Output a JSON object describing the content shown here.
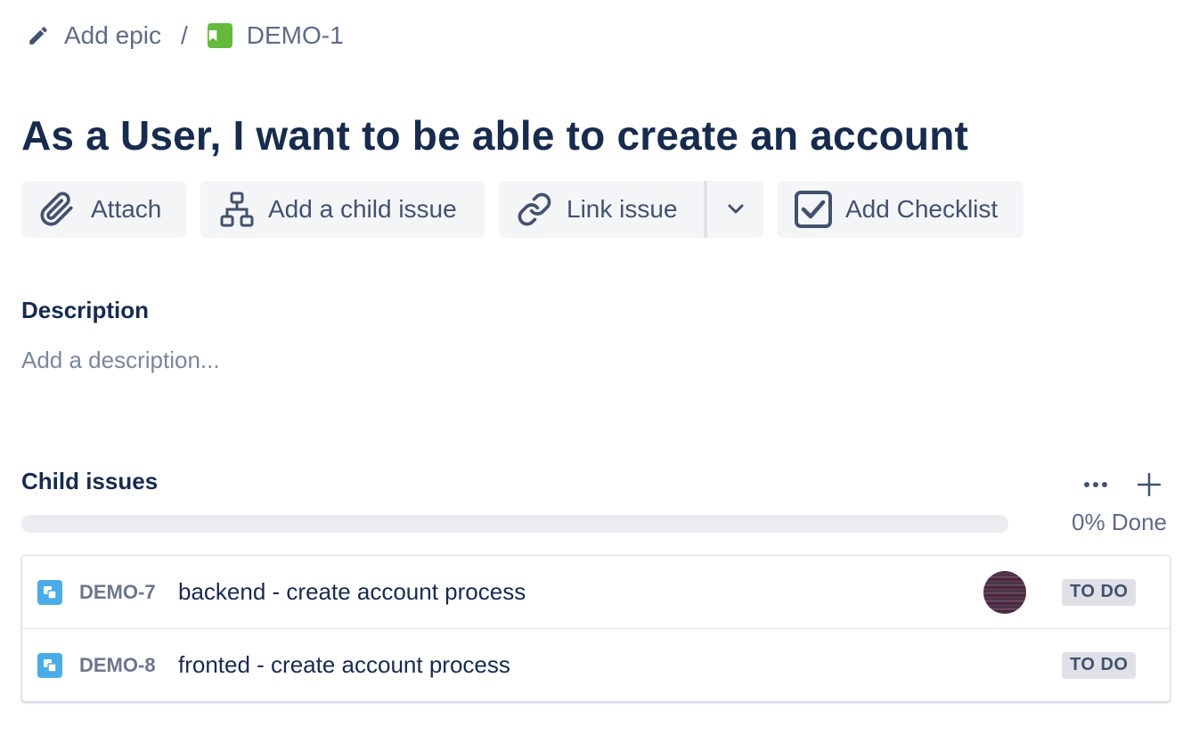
{
  "breadcrumb": {
    "epic_label": "Add epic",
    "separator": "/",
    "issue_key": "DEMO-1",
    "issue_type_icon": "story-bookmark-icon"
  },
  "title": "As a User, I want to be able to create an account",
  "toolbar": {
    "attach": "Attach",
    "add_child": "Add a child issue",
    "link_issue": "Link issue",
    "add_checklist": "Add Checklist"
  },
  "description": {
    "heading": "Description",
    "placeholder": "Add a description..."
  },
  "child_issues": {
    "heading": "Child issues",
    "progress_done_fraction": 0,
    "progress_label": "0% Done",
    "items": [
      {
        "key": "DEMO-7",
        "summary": "backend - create account process",
        "status": "TO DO",
        "has_assignee": true
      },
      {
        "key": "DEMO-8",
        "summary": "fronted - create account process",
        "status": "TO DO",
        "has_assignee": false
      }
    ]
  },
  "colors": {
    "story": "#63ba3c",
    "subtask": "#4bade8",
    "button_bg": "#f4f5f7",
    "heading": "#172b4d"
  }
}
